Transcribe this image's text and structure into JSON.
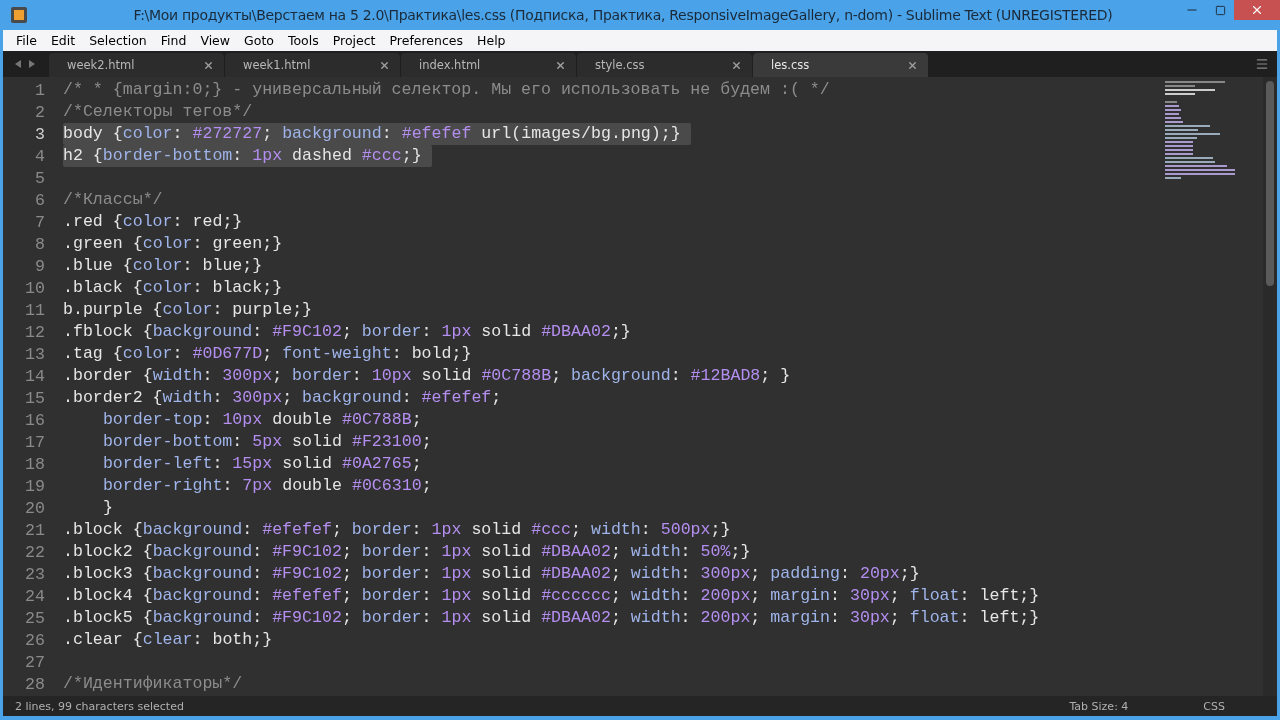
{
  "window": {
    "title": "F:\\Мои продукты\\Верстаем на 5 2.0\\Практика\\les.css (Подписка, Практика, ResponsiveImageGallery, n-dom) - Sublime Text (UNREGISTERED)"
  },
  "menu": [
    "File",
    "Edit",
    "Selection",
    "Find",
    "View",
    "Goto",
    "Tools",
    "Project",
    "Preferences",
    "Help"
  ],
  "tabs": [
    {
      "label": "week2.html",
      "selected": false
    },
    {
      "label": "week1.html",
      "selected": false
    },
    {
      "label": "index.html",
      "selected": false
    },
    {
      "label": "style.css",
      "selected": false
    },
    {
      "label": "les.css",
      "selected": true
    }
  ],
  "editor": {
    "lines": [
      {
        "number": "1",
        "text": "/* * {margin:0;} - универсальный селектор. Мы его использовать не будем :( */",
        "selected": false,
        "kind": "comment"
      },
      {
        "number": "2",
        "text": "/*Селекторы тегов*/",
        "selected": false,
        "kind": "comment"
      },
      {
        "number": "3",
        "text": "body {color: #272727; background: #efefef url(images/bg.png);}",
        "selected": true,
        "kind": "code"
      },
      {
        "number": "4",
        "text": "h2 {border-bottom: 1px dashed #ccc;}",
        "selected": true,
        "kind": "code"
      },
      {
        "number": "5"
      },
      {
        "number": "6",
        "text": "/*Классы*/",
        "selected": false,
        "kind": "comment"
      },
      {
        "number": "7",
        "text": ".red {color: red;}",
        "selected": false,
        "kind": "code"
      },
      {
        "number": "8",
        "text": ".green {color: green;}",
        "selected": false,
        "kind": "code"
      },
      {
        "number": "9",
        "text": ".blue {color: blue;}",
        "selected": false,
        "kind": "code"
      },
      {
        "number": "10",
        "text": ".black {color: black;}",
        "selected": false,
        "kind": "code"
      },
      {
        "number": "11",
        "text": "b.purple {color: purple;}",
        "selected": false,
        "kind": "code"
      },
      {
        "number": "12",
        "text": ".fblock {background: #F9C102; border: 1px solid #DBAA02;}",
        "selected": false,
        "kind": "code"
      },
      {
        "number": "13",
        "text": ".tag {color: #0D677D; font-weight: bold;}",
        "selected": false,
        "kind": "code"
      },
      {
        "number": "14",
        "text": ".border {width: 300px; border: 10px solid #0C788B; background: #12BAD8; }",
        "selected": false,
        "kind": "code"
      },
      {
        "number": "15",
        "text": ".border2 {width: 300px; background: #efefef;",
        "selected": false,
        "kind": "code"
      },
      {
        "number": "16",
        "text": "    border-top: 10px double #0C788B;",
        "selected": false,
        "kind": "code"
      },
      {
        "number": "17",
        "text": "    border-bottom: 5px solid #F23100;",
        "selected": false,
        "kind": "code"
      },
      {
        "number": "18",
        "text": "    border-left: 15px solid #0A2765;",
        "selected": false,
        "kind": "code"
      },
      {
        "number": "19",
        "text": "    border-right: 7px double #0C6310;",
        "selected": false,
        "kind": "code"
      },
      {
        "number": "20",
        "text": "    }",
        "selected": false,
        "kind": "code"
      },
      {
        "number": "21",
        "text": ".block {background: #efefef; border: 1px solid #ccc; width: 500px;}",
        "selected": false,
        "kind": "code"
      },
      {
        "number": "22",
        "text": ".block2 {background: #F9C102; border: 1px solid #DBAA02; width: 50%;}",
        "selected": false,
        "kind": "code"
      },
      {
        "number": "23",
        "text": ".block3 {background: #F9C102; border: 1px solid #DBAA02; width: 300px; padding: 20px;}",
        "selected": false,
        "kind": "code"
      },
      {
        "number": "24",
        "text": ".block4 {background: #efefef; border: 1px solid #cccccc; width: 200px; margin: 30px; float: left;}",
        "selected": false,
        "kind": "code"
      },
      {
        "number": "25",
        "text": ".block5 {background: #F9C102; border: 1px solid #DBAA02; width: 200px; margin: 30px; float: left;}",
        "selected": false,
        "kind": "code"
      },
      {
        "number": "26",
        "text": ".clear {clear: both;}",
        "selected": false,
        "kind": "code"
      },
      {
        "number": "27"
      },
      {
        "number": "28",
        "text": "/*Идентификаторы*/",
        "selected": false,
        "kind": "comment"
      }
    ]
  },
  "status_bar": {
    "selection": "2 lines, 99 characters selected",
    "tab_size": "Tab Size: 4",
    "syntax": "CSS"
  }
}
